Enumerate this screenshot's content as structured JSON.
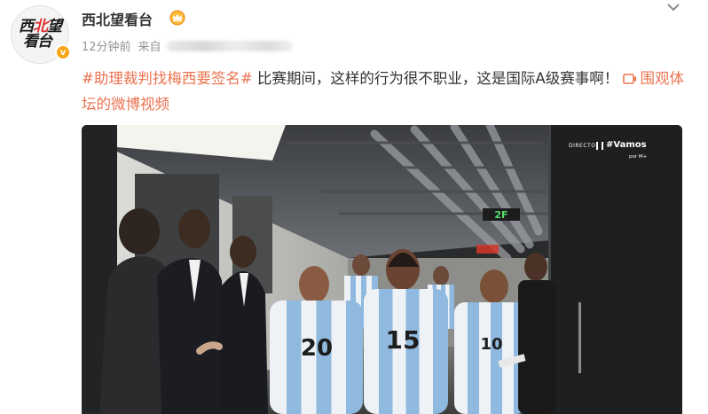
{
  "post": {
    "username": "西北望看台",
    "time": "12分钟前",
    "source_prefix": "来自",
    "hashtag": "#助理裁判找梅西要签名#",
    "text": "比赛期间，这样的行为很不职业，这是国际A级赛事啊！",
    "video_link": "围观体坛的微博视频",
    "avatar_line1_a": "西",
    "avatar_line1_b": "北",
    "avatar_line1_c": "望",
    "avatar_line2": "看台",
    "verified_badge": "v"
  },
  "video": {
    "watermark_directo": "DIRECTO",
    "watermark_brand": "#Vamos",
    "watermark_by": "por M+",
    "floor_sign": "2F",
    "jersey_numbers": [
      "20",
      "15",
      "10"
    ]
  },
  "icons": {
    "crown": "crown-icon",
    "chevron": "chevron-down-icon",
    "video": "video-play-icon"
  },
  "colors": {
    "hashtag": "#eb7350",
    "username": "#333333",
    "meta": "#939393",
    "badge": "#f9a51a"
  }
}
